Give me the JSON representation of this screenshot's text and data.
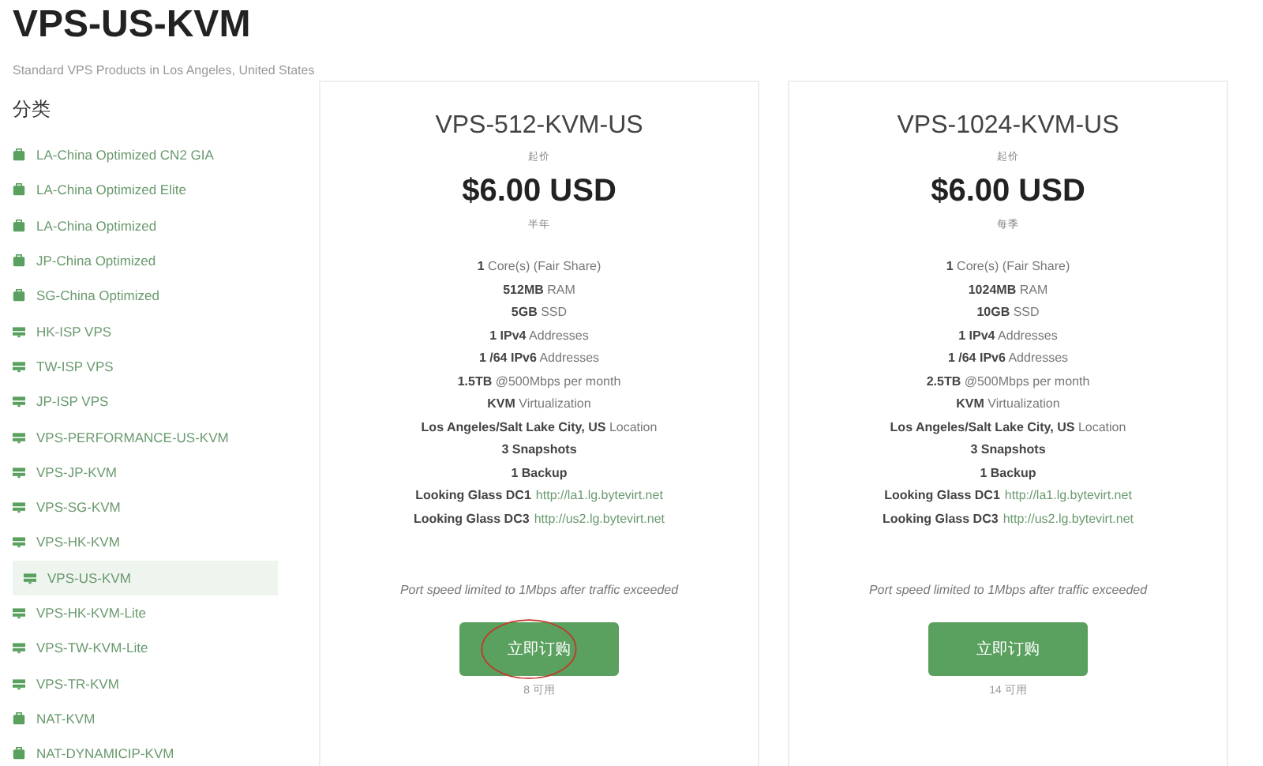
{
  "page": {
    "title": "VPS-US-KVM",
    "subtitle": "Standard VPS Products in Los Angeles, United States"
  },
  "sidebar": {
    "heading": "分类",
    "items": [
      {
        "label": "LA-China Optimized CN2 GIA",
        "kind": "box",
        "selected": false
      },
      {
        "label": "LA-China Optimized Elite",
        "kind": "box",
        "selected": false
      },
      {
        "label": "LA-China Optimized",
        "kind": "box",
        "selected": false
      },
      {
        "label": "JP-China Optimized",
        "kind": "box",
        "selected": false
      },
      {
        "label": "SG-China Optimized",
        "kind": "box",
        "selected": false
      },
      {
        "label": "HK-ISP VPS",
        "kind": "server",
        "selected": false
      },
      {
        "label": "TW-ISP VPS",
        "kind": "server",
        "selected": false
      },
      {
        "label": "JP-ISP VPS",
        "kind": "server",
        "selected": false
      },
      {
        "label": "VPS-PERFORMANCE-US-KVM",
        "kind": "server",
        "selected": false
      },
      {
        "label": "VPS-JP-KVM",
        "kind": "server",
        "selected": false
      },
      {
        "label": "VPS-SG-KVM",
        "kind": "server",
        "selected": false
      },
      {
        "label": "VPS-HK-KVM",
        "kind": "server",
        "selected": false
      },
      {
        "label": "VPS-US-KVM",
        "kind": "server",
        "selected": true
      },
      {
        "label": "VPS-HK-KVM-Lite",
        "kind": "server",
        "selected": false
      },
      {
        "label": "VPS-TW-KVM-Lite",
        "kind": "server",
        "selected": false
      },
      {
        "label": "VPS-TR-KVM",
        "kind": "server",
        "selected": false
      },
      {
        "label": "NAT-KVM",
        "kind": "box",
        "selected": false
      },
      {
        "label": "NAT-DYNAMICIP-KVM",
        "kind": "box",
        "selected": false
      }
    ]
  },
  "plans": [
    {
      "name": "VPS-512-KVM-US",
      "price_label": "起价",
      "price": "$6.00 USD",
      "period": "半年",
      "features": [
        {
          "kind": "text",
          "text": "**1** Core(s) (Fair Share)"
        },
        {
          "kind": "text",
          "text": "**512MB** RAM"
        },
        {
          "kind": "text",
          "text": "**5GB** SSD"
        },
        {
          "kind": "text",
          "text": "**1 IPv4** Addresses"
        },
        {
          "kind": "text",
          "text": "**1 /64 IPv6** Addresses"
        },
        {
          "kind": "text",
          "text": "**1.5TB** @500Mbps per month"
        },
        {
          "kind": "text",
          "text": "**KVM** Virtualization"
        },
        {
          "kind": "text",
          "text": "**Los Angeles/Salt Lake City, US** Location"
        },
        {
          "kind": "text",
          "text": "**3 Snapshots**"
        },
        {
          "kind": "text",
          "text": "**1 Backup**"
        },
        {
          "kind": "link",
          "label": "Looking Glass DC1",
          "link": "http://la1.lg.bytevirt.net"
        },
        {
          "kind": "link",
          "label": "Looking Glass DC3",
          "link": "http://us2.lg.bytevirt.net"
        }
      ],
      "note": "Port speed limited to 1Mbps after traffic exceeded",
      "button": "立即订购",
      "circled": true,
      "available": "8 可用"
    },
    {
      "name": "VPS-1024-KVM-US",
      "price_label": "起价",
      "price": "$6.00 USD",
      "period": "每季",
      "features": [
        {
          "kind": "text",
          "text": "**1** Core(s) (Fair Share)"
        },
        {
          "kind": "text",
          "text": "**1024MB** RAM"
        },
        {
          "kind": "text",
          "text": "**10GB** SSD"
        },
        {
          "kind": "text",
          "text": "**1 IPv4** Addresses"
        },
        {
          "kind": "text",
          "text": "**1 /64 IPv6** Addresses"
        },
        {
          "kind": "text",
          "text": "**2.5TB** @500Mbps per month"
        },
        {
          "kind": "text",
          "text": "**KVM** Virtualization"
        },
        {
          "kind": "text",
          "text": "**Los Angeles/Salt Lake City, US** Location"
        },
        {
          "kind": "text",
          "text": "**3 Snapshots**"
        },
        {
          "kind": "text",
          "text": "**1 Backup**"
        },
        {
          "kind": "link",
          "label": "Looking Glass DC1",
          "link": "http://la1.lg.bytevirt.net"
        },
        {
          "kind": "link",
          "label": "Looking Glass DC3",
          "link": "http://us2.lg.bytevirt.net"
        }
      ],
      "note": "Port speed limited to 1Mbps after traffic exceeded",
      "button": "立即订购",
      "circled": false,
      "available": "14 可用"
    }
  ]
}
